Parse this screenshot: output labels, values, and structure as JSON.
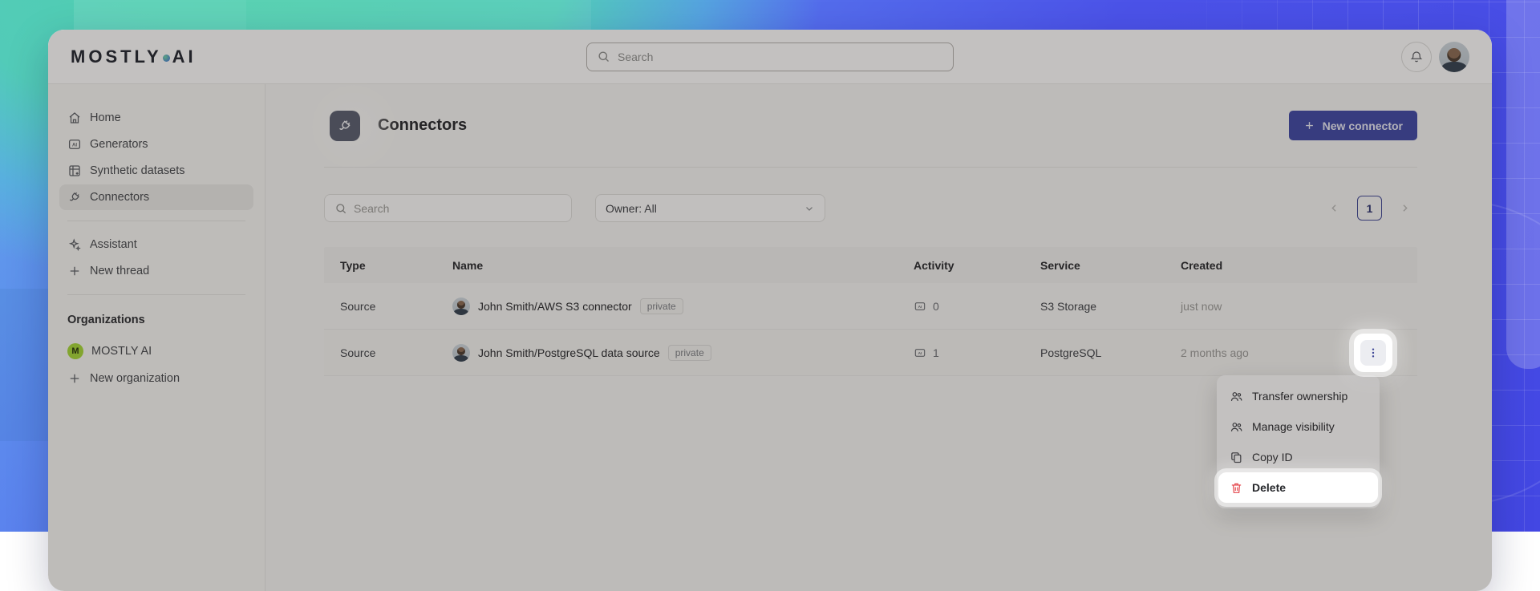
{
  "brand": {
    "logo_left": "MOSTLY",
    "logo_right": "AI"
  },
  "topbar": {
    "search_placeholder": "Search"
  },
  "sidebar": {
    "items": [
      {
        "label": "Home"
      },
      {
        "label": "Generators"
      },
      {
        "label": "Synthetic datasets"
      },
      {
        "label": "Connectors"
      }
    ],
    "assistant_label": "Assistant",
    "new_thread_label": "New thread",
    "organizations_title": "Organizations",
    "org": {
      "badge": "M",
      "label": "MOSTLY AI"
    },
    "new_org_label": "New organization"
  },
  "main": {
    "title": "Connectors",
    "new_connector_label": "New connector",
    "filters": {
      "search_placeholder": "Search",
      "owner_value": "Owner: All"
    },
    "pagination": {
      "current_page": "1"
    },
    "table": {
      "columns": [
        "Type",
        "Name",
        "Activity",
        "Service",
        "Created"
      ],
      "rows": [
        {
          "type": "Source",
          "name": "John Smith/AWS S3 connector",
          "badge": "private",
          "activity": "0",
          "service": "S3 Storage",
          "created": "just now"
        },
        {
          "type": "Source",
          "name": "John Smith/PostgreSQL data source",
          "badge": "private",
          "activity": "1",
          "service": "PostgreSQL",
          "created": "2 months ago"
        }
      ]
    },
    "context_menu": {
      "items": [
        {
          "label": "Transfer ownership"
        },
        {
          "label": "Manage visibility"
        },
        {
          "label": "Copy ID"
        },
        {
          "label": "Delete"
        }
      ]
    }
  },
  "colors": {
    "accent_navy": "#3d47a5",
    "brand_green": "#a6d936",
    "danger_red": "#e5484d",
    "bg_teal": "#4fd0ad",
    "bg_blue": "#4b52e8"
  }
}
